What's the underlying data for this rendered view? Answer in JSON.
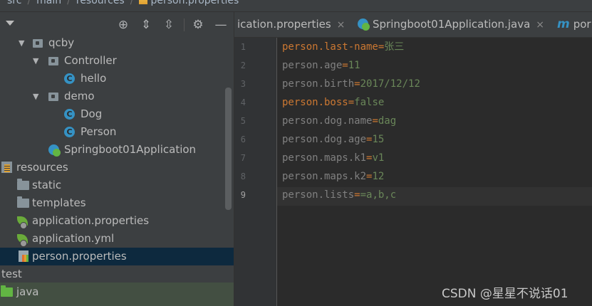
{
  "breadcrumb": {
    "items": [
      "src",
      "main",
      "resources",
      "person.properties"
    ]
  },
  "toolbar": {
    "icons": [
      "locate-icon",
      "expand-all-icon",
      "collapse-all-icon",
      "gear-icon",
      "minimize-icon"
    ]
  },
  "tree": {
    "items": [
      {
        "label": "qcby",
        "type": "package",
        "expanded": true
      },
      {
        "label": "Controller",
        "type": "package",
        "expanded": true
      },
      {
        "label": "hello",
        "type": "class"
      },
      {
        "label": "demo",
        "type": "package",
        "expanded": true
      },
      {
        "label": "Dog",
        "type": "class"
      },
      {
        "label": "Person",
        "type": "class"
      },
      {
        "label": "Springboot01Application",
        "type": "spring-class"
      },
      {
        "label": "resources",
        "type": "resources-folder"
      },
      {
        "label": "static",
        "type": "folder"
      },
      {
        "label": "templates",
        "type": "folder"
      },
      {
        "label": "application.properties",
        "type": "spring-config"
      },
      {
        "label": "application.yml",
        "type": "spring-config"
      },
      {
        "label": "person.properties",
        "type": "properties",
        "selected": true
      },
      {
        "label": "test",
        "type": "folder"
      },
      {
        "label": "java",
        "type": "test-folder"
      }
    ]
  },
  "tabs": [
    {
      "label": "ication.properties",
      "close": "×"
    },
    {
      "label": "Springboot01Application.java",
      "close": "×"
    },
    {
      "label": "por",
      "icon": "m"
    }
  ],
  "editor": {
    "current_line": 9,
    "lines": [
      {
        "no": "1",
        "key": "person.last-name",
        "eq": "=",
        "value": "张三",
        "highlight": true
      },
      {
        "no": "2",
        "key": "person.age",
        "eq": "=",
        "value": "11",
        "highlight": false
      },
      {
        "no": "3",
        "key": "person.birth",
        "eq": "=",
        "value": "2017/12/12",
        "highlight": false
      },
      {
        "no": "4",
        "key": "person.boss",
        "eq": "=",
        "value": "false",
        "highlight": true
      },
      {
        "no": "5",
        "key": "person.dog.name",
        "eq": "=",
        "value": "dag",
        "highlight": false
      },
      {
        "no": "6",
        "key": "person.dog.age",
        "eq": "=",
        "value": "15",
        "highlight": false
      },
      {
        "no": "7",
        "key": "person.maps.k1",
        "eq": "=",
        "value": "v1",
        "highlight": false
      },
      {
        "no": "8",
        "key": "person.maps.k2",
        "eq": "=",
        "value": "12",
        "highlight": false
      },
      {
        "no": "9",
        "key": "person.lists",
        "eq": "=",
        "value": "=a,b,c",
        "highlight": false
      }
    ]
  },
  "watermark": "CSDN @星星不说话01",
  "colors": {
    "panel_bg": "#3c3f41",
    "editor_bg": "#2b2b2b",
    "selection": "#0d293e",
    "key_highlight": "#cc7832",
    "value_green": "#6a8759"
  }
}
